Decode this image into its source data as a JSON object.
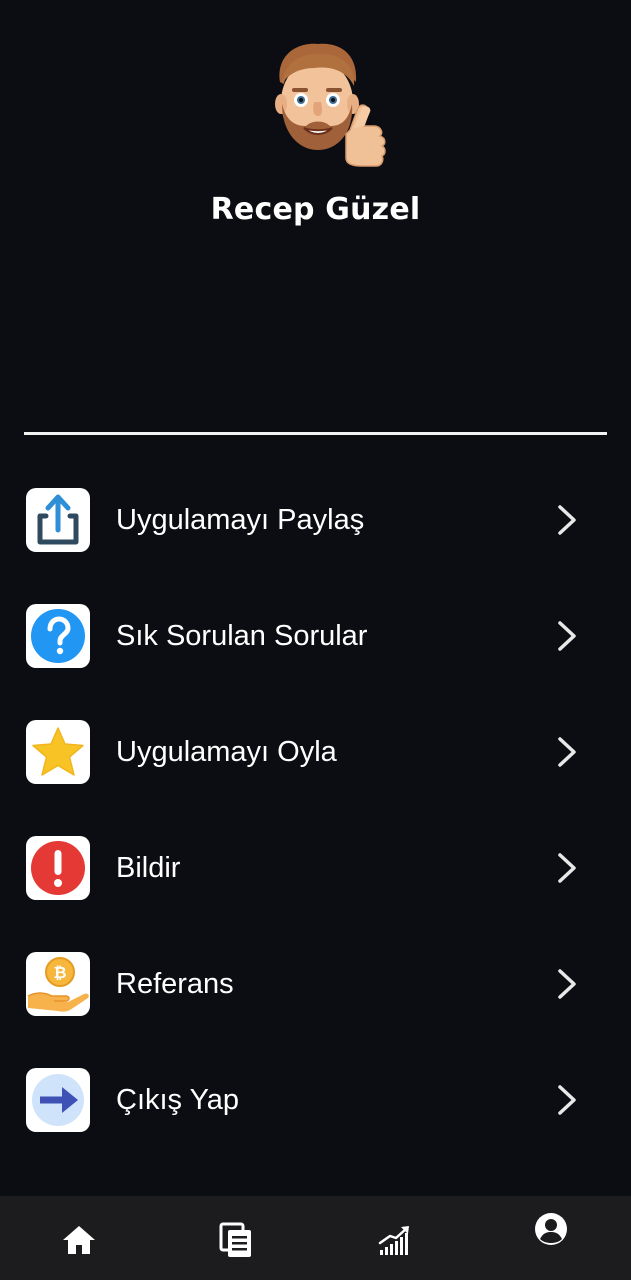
{
  "profile": {
    "name": "Recep Güzel",
    "avatar_icon": "memoji-thumbs-up-avatar"
  },
  "menu": {
    "items": [
      {
        "label": "Uygulamayı Paylaş",
        "icon": "share-icon",
        "color": "#2e8fd6"
      },
      {
        "label": "Sık Sorulan Sorular",
        "icon": "question-icon",
        "color": "#2196f3"
      },
      {
        "label": "Uygulamayı Oyla",
        "icon": "star-icon",
        "color": "#f7c325"
      },
      {
        "label": "Bildir",
        "icon": "alert-icon",
        "color": "#e53935"
      },
      {
        "label": "Referans",
        "icon": "referral-coin-icon",
        "color": "#f6b73c"
      },
      {
        "label": "Çıkış Yap",
        "icon": "logout-arrow-icon",
        "color": "#3f51b5"
      }
    ]
  },
  "bottom_nav": {
    "items": [
      {
        "icon": "home-icon",
        "active": false
      },
      {
        "icon": "documents-icon",
        "active": false
      },
      {
        "icon": "chart-icon",
        "active": false
      },
      {
        "icon": "profile-icon",
        "active": true
      }
    ]
  },
  "colors": {
    "background": "#0c0d13",
    "nav_background": "#1c1c1e",
    "text": "#ffffff"
  }
}
